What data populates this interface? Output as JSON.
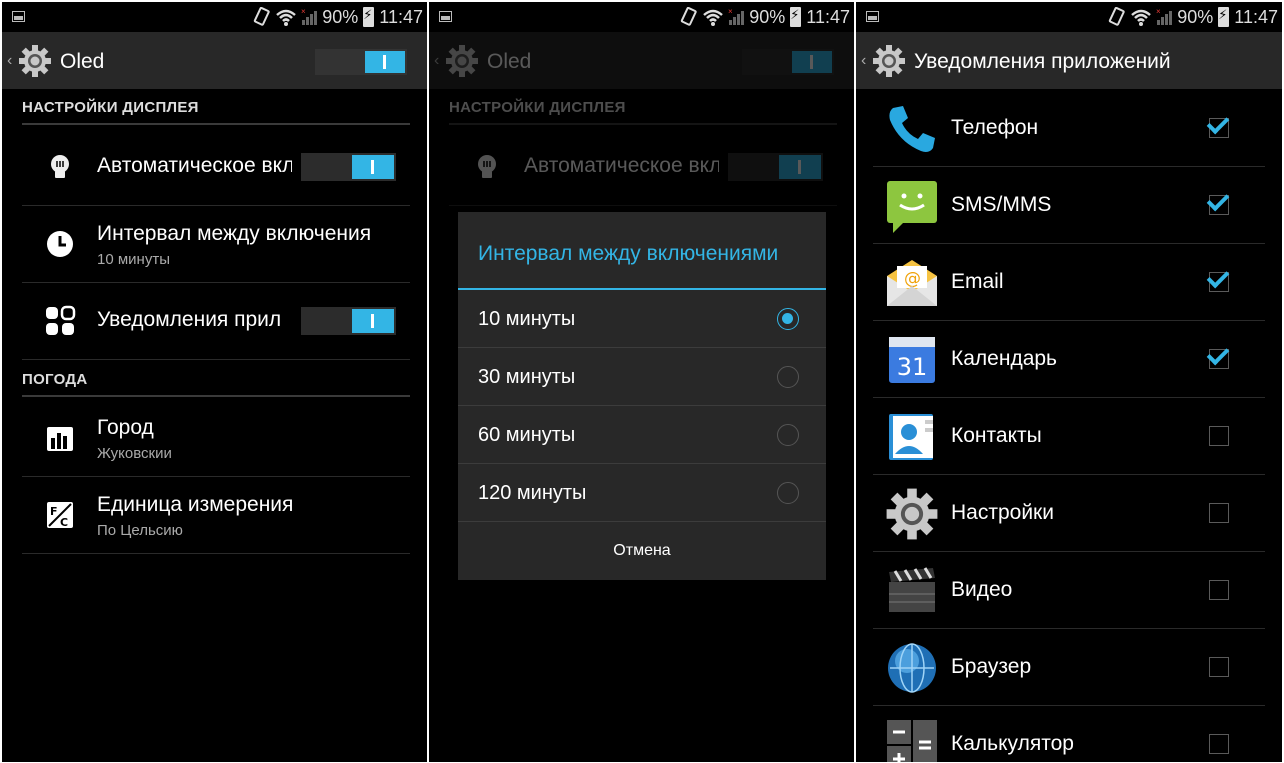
{
  "status_bar": {
    "battery": "90%",
    "time": "11:47"
  },
  "screen1": {
    "title": "Oled",
    "sections": {
      "display": "НАСТРОЙКИ ДИСПЛЕЯ",
      "weather": "ПОГОДА"
    },
    "prefs": {
      "auto": {
        "title": "Автоматическое вкл",
        "switch_on": true
      },
      "interval": {
        "title": "Интервал между включения",
        "summary": "10 минуты"
      },
      "notifications": {
        "title": "Уведомления прил",
        "switch_on": true
      },
      "city": {
        "title": "Город",
        "summary": "Жуковскии"
      },
      "units": {
        "title": "Единица измерения",
        "summary": "По Цельсию"
      }
    }
  },
  "screen2": {
    "dialog": {
      "title": "Интервал между включениями",
      "options": [
        {
          "label": "10 минуты",
          "selected": true
        },
        {
          "label": "30 минуты",
          "selected": false
        },
        {
          "label": "60 минуты",
          "selected": false
        },
        {
          "label": "120 минуты",
          "selected": false
        }
      ],
      "cancel": "Отмена"
    }
  },
  "screen3": {
    "title": "Уведомления приложений",
    "apps": [
      {
        "label": "Телефон",
        "icon": "phone-icon",
        "checked": true
      },
      {
        "label": "SMS/MMS",
        "icon": "sms-icon",
        "checked": true
      },
      {
        "label": "Email",
        "icon": "email-icon",
        "checked": true
      },
      {
        "label": "Календарь",
        "icon": "calendar-icon",
        "calendar_day": "31",
        "checked": true
      },
      {
        "label": "Контакты",
        "icon": "contacts-icon",
        "checked": false
      },
      {
        "label": "Настройки",
        "icon": "settings-icon",
        "checked": false
      },
      {
        "label": "Видео",
        "icon": "video-icon",
        "checked": false
      },
      {
        "label": "Браузер",
        "icon": "browser-icon",
        "checked": false
      },
      {
        "label": "Калькулятор",
        "icon": "calculator-icon",
        "checked": false
      }
    ]
  },
  "colors": {
    "accent": "#33b5e5",
    "actionbar": "#282828",
    "background": "#000000"
  }
}
